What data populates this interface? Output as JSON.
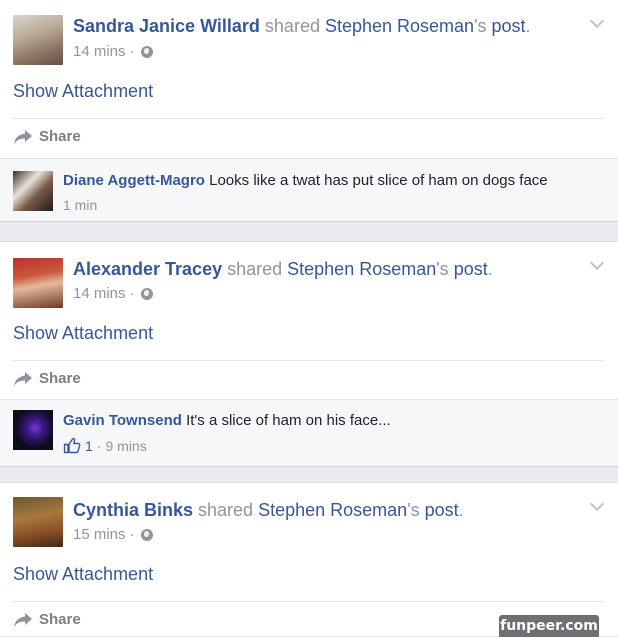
{
  "posts": [
    {
      "author": "Sandra Janice Willard",
      "verb": " shared ",
      "source_name": "Stephen Roseman",
      "source_suffix": "'s ",
      "source_post": "post",
      "period": ".",
      "time": "14 mins",
      "dot": "·",
      "attachment_label": "Show Attachment",
      "share_label": "Share",
      "comment": {
        "author": "Diane Aggett-Magro",
        "text": "Looks like a twat has put slice of ham on dogs face",
        "time": "1 min"
      }
    },
    {
      "author": "Alexander Tracey",
      "verb": " shared ",
      "source_name": "Stephen Roseman",
      "source_suffix": "'s ",
      "source_post": "post",
      "period": ".",
      "time": "14 mins",
      "dot": "·",
      "attachment_label": "Show Attachment",
      "share_label": "Share",
      "comment": {
        "author": "Gavin Townsend",
        "text": "It's a slice of ham on his face...",
        "likes": "1",
        "dot": "·",
        "time": "9 mins"
      }
    },
    {
      "author": "Cynthia Binks",
      "verb": " shared ",
      "source_name": "Stephen Roseman",
      "source_suffix": "'s ",
      "source_post": "post",
      "period": ".",
      "time": "15 mins",
      "dot": "·",
      "attachment_label": "Show Attachment",
      "share_label": "Share"
    }
  ],
  "watermark": "funpeer.com",
  "colors": {
    "link": "#365899",
    "meta": "#90949c",
    "comment_bg": "#f6f7f9",
    "page_bg": "#e9ebee"
  },
  "icons": {
    "share": "share-arrow-icon",
    "audience": "globe-icon",
    "menu": "chevron-down-icon",
    "like": "thumbs-up-icon"
  }
}
